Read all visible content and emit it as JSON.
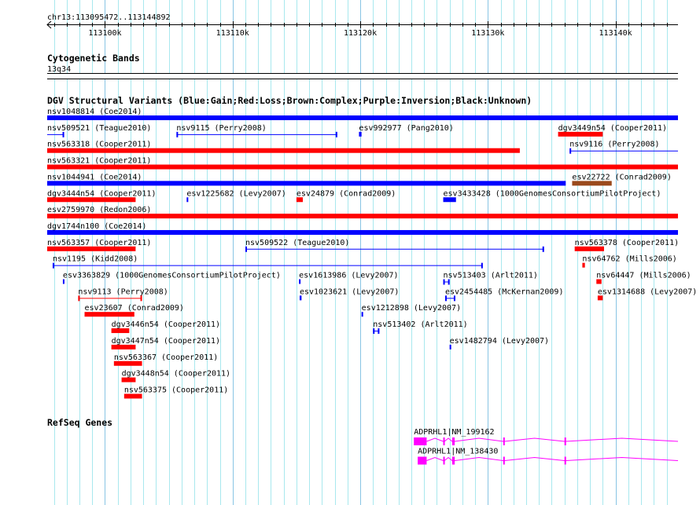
{
  "colors": {
    "blue": "#0000ff",
    "red": "#ff0000",
    "brown": "#9a4a1c",
    "magenta": "#ff00ff",
    "grid": "#a8e8ee",
    "grid_major": "#88c4e4"
  },
  "ruler": {
    "title": "chr13:113095472..113144892",
    "start": 113095472,
    "end": 113144892,
    "ticks": [
      {
        "pos": 113100000,
        "label": "113100k"
      },
      {
        "pos": 113110000,
        "label": "113110k"
      },
      {
        "pos": 113120000,
        "label": "113120k"
      },
      {
        "pos": 113130000,
        "label": "113130k"
      },
      {
        "pos": 113140000,
        "label": "113140k"
      }
    ]
  },
  "cytoband": {
    "title": "Cytogenetic Bands",
    "band": "13q34"
  },
  "variants": {
    "title": "DGV Structural Variants (Blue:Gain;Red:Loss;Brown:Complex;Purple:Inversion;Black:Unknown)",
    "rows": [
      [
        {
          "label": "nsv1048814 (Coe2014)",
          "start": 113095.0,
          "end": 113145.5,
          "color": "blue",
          "style": "bar"
        }
      ],
      [
        {
          "label": "nsv509521 (Teague2010)",
          "start": 113095.0,
          "end": 113096.8,
          "color": "blue",
          "style": "line"
        },
        {
          "label": "nsv9115 (Perry2008)",
          "start": 113105.6,
          "end": 113118.2,
          "color": "blue",
          "style": "line"
        },
        {
          "label": "esv992977 (Pang2010)",
          "start": 113119.9,
          "end": 113120.1,
          "color": "blue",
          "style": "bar"
        },
        {
          "label": "dgv3449n54 (Cooper2011)",
          "start": 113135.5,
          "end": 113139.0,
          "color": "red",
          "style": "bar"
        }
      ],
      [
        {
          "label": "nsv563318 (Cooper2011)",
          "start": 113095.0,
          "end": 113132.5,
          "color": "red",
          "style": "bar"
        },
        {
          "label": "nsv9116 (Perry2008)",
          "start": 113136.4,
          "end": 113145.5,
          "color": "blue",
          "style": "line"
        }
      ],
      [
        {
          "label": "nsv563321 (Cooper2011)",
          "start": 113095.0,
          "end": 113145.5,
          "color": "red",
          "style": "bar"
        }
      ],
      [
        {
          "label": "nsv1044941 (Coe2014)",
          "start": 113095.0,
          "end": 113136.1,
          "color": "blue",
          "style": "bar"
        },
        {
          "label": "esv22722 (Conrad2009)",
          "start": 113136.6,
          "end": 113139.7,
          "color": "brown",
          "style": "bar"
        }
      ],
      [
        {
          "label": "dgv3444n54 (Cooper2011)",
          "start": 113095.0,
          "end": 113102.4,
          "color": "red",
          "style": "bar"
        },
        {
          "label": "esv1225682 (Levy2007)",
          "start": 113106.4,
          "end": 113106.5,
          "color": "blue",
          "style": "bar"
        },
        {
          "label": "esv24879 (Conrad2009)",
          "start": 113115.0,
          "end": 113115.5,
          "color": "red",
          "style": "bar"
        },
        {
          "label": "esv3433428 (1000GenomesConsortiumPilotProject)",
          "start": 113126.5,
          "end": 113127.5,
          "color": "blue",
          "style": "bar"
        }
      ],
      [
        {
          "label": "esv2759970 (Redon2006)",
          "start": 113095.0,
          "end": 113145.5,
          "color": "red",
          "style": "bar"
        }
      ],
      [
        {
          "label": "dgv1744n100 (Coe2014)",
          "start": 113095.0,
          "end": 113145.5,
          "color": "blue",
          "style": "bar"
        }
      ],
      [
        {
          "label": "nsv563357 (Cooper2011)",
          "start": 113095.0,
          "end": 113102.4,
          "color": "red",
          "style": "bar"
        },
        {
          "label": "nsv509522 (Teague2010)",
          "start": 113111.0,
          "end": 113134.4,
          "color": "blue",
          "style": "line"
        },
        {
          "label": "nsv563378 (Cooper2011)",
          "start": 113136.8,
          "end": 113139.1,
          "color": "red",
          "style": "bar"
        }
      ],
      [
        {
          "label": "nsv1195 (Kidd2008)",
          "start": 113095.9,
          "end": 113129.6,
          "color": "blue",
          "style": "line"
        },
        {
          "label": "nsv64762 (Mills2006)",
          "start": 113137.4,
          "end": 113137.6,
          "color": "red",
          "style": "bar"
        }
      ],
      [
        {
          "label": "esv3363829 (1000GenomesConsortiumPilotProject)",
          "start": 113096.7,
          "end": 113096.8,
          "color": "blue",
          "style": "bar"
        },
        {
          "label": "esv1613986 (Levy2007)",
          "start": 113115.2,
          "end": 113115.3,
          "color": "blue",
          "style": "bar"
        },
        {
          "label": "nsv513403 (Arlt2011)",
          "start": 113126.5,
          "end": 113127.0,
          "color": "blue",
          "style": "line"
        },
        {
          "label": "nsv64447 (Mills2006)",
          "start": 113138.5,
          "end": 113138.9,
          "color": "red",
          "style": "bar"
        }
      ],
      [
        {
          "label": "nsv9113 (Perry2008)",
          "start": 113097.9,
          "end": 113102.9,
          "color": "red",
          "style": "line"
        },
        {
          "label": "esv1023621 (Levy2007)",
          "start": 113115.25,
          "end": 113115.4,
          "color": "blue",
          "style": "bar"
        },
        {
          "label": "esv2454485 (McKernan2009)",
          "start": 113126.65,
          "end": 113127.45,
          "color": "blue",
          "style": "line"
        },
        {
          "label": "esv1314688 (Levy2007)",
          "start": 113138.6,
          "end": 113139.0,
          "color": "red",
          "style": "bar"
        }
      ],
      [
        {
          "label": "esv23607 (Conrad2009)",
          "start": 113098.4,
          "end": 113102.3,
          "color": "red",
          "style": "bar"
        },
        {
          "label": "esv1212898 (Levy2007)",
          "start": 113120.1,
          "end": 113120.2,
          "color": "blue",
          "style": "bar"
        }
      ],
      [
        {
          "label": "dgv3446n54 (Cooper2011)",
          "start": 113100.5,
          "end": 113101.9,
          "color": "red",
          "style": "bar"
        },
        {
          "label": "nsv513402 (Arlt2011)",
          "start": 113121.0,
          "end": 113121.5,
          "color": "blue",
          "style": "line"
        }
      ],
      [
        {
          "label": "dgv3447n54 (Cooper2011)",
          "start": 113100.5,
          "end": 113102.4,
          "color": "red",
          "style": "bar"
        },
        {
          "label": "esv1482794 (Levy2007)",
          "start": 113127.0,
          "end": 113127.1,
          "color": "blue",
          "style": "bar"
        }
      ],
      [
        {
          "label": "nsv563367 (Cooper2011)",
          "start": 113100.7,
          "end": 113102.9,
          "color": "red",
          "style": "bar"
        }
      ],
      [
        {
          "label": "dgv3448n54 (Cooper2011)",
          "start": 113101.3,
          "end": 113102.4,
          "color": "red",
          "style": "bar"
        }
      ],
      [
        {
          "label": "nsv563375 (Cooper2011)",
          "start": 113101.5,
          "end": 113102.9,
          "color": "red",
          "style": "bar"
        }
      ]
    ]
  },
  "genes": {
    "title": "RefSeq Genes",
    "transcripts": [
      {
        "label": "ADPRHL1|NM_199162",
        "end": 113145.5,
        "exons": [
          [
            113124.2,
            113125.2
          ],
          [
            113126.5,
            113126.6
          ],
          [
            113127.2,
            113127.4
          ],
          [
            113131.2,
            113131.3
          ],
          [
            113136.0,
            113136.1
          ]
        ]
      },
      {
        "label": "ADPRHL1|NM_138430",
        "end": 113145.5,
        "exons": [
          [
            113124.5,
            113125.2
          ],
          [
            113126.5,
            113126.6
          ],
          [
            113127.2,
            113127.4
          ],
          [
            113131.2,
            113131.3
          ],
          [
            113136.0,
            113136.1
          ]
        ]
      }
    ]
  }
}
